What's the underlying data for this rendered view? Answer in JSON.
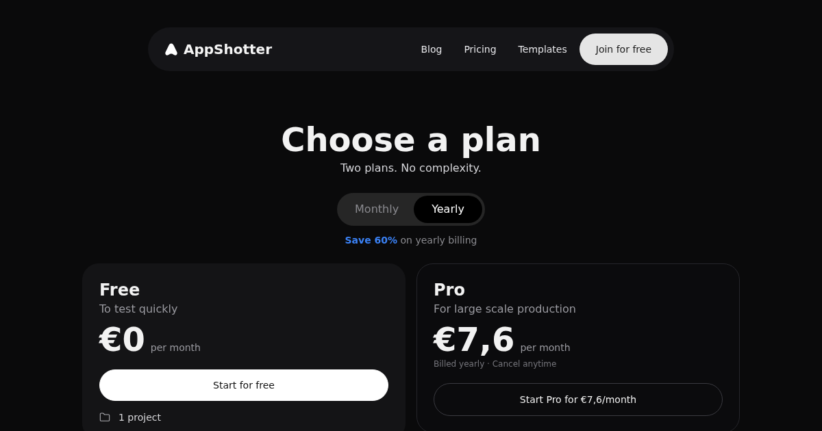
{
  "nav": {
    "brand": "AppShotter",
    "links": [
      {
        "label": "Blog"
      },
      {
        "label": "Pricing"
      },
      {
        "label": "Templates"
      }
    ],
    "cta": "Join for free"
  },
  "hero": {
    "title": "Choose a plan",
    "subtitle": "Two plans. No complexity."
  },
  "billing": {
    "options": [
      {
        "label": "Monthly",
        "selected": false
      },
      {
        "label": "Yearly",
        "selected": true
      }
    ],
    "note": "**Save 60%** on yearly billing"
  },
  "plans": [
    {
      "kind": "filled",
      "name": "Free",
      "tagline": "To test quickly",
      "price": "€0",
      "period": "per month",
      "cta": "Start for free",
      "features": [
        {
          "label": "1 project"
        }
      ]
    },
    {
      "kind": "outlined",
      "name": "Pro",
      "tagline": "For large scale production",
      "price": "€7,6",
      "period": "per month",
      "note": "Billed yearly · Cancel anytime",
      "cta": "Start Pro for €7,6/month"
    }
  ]
}
